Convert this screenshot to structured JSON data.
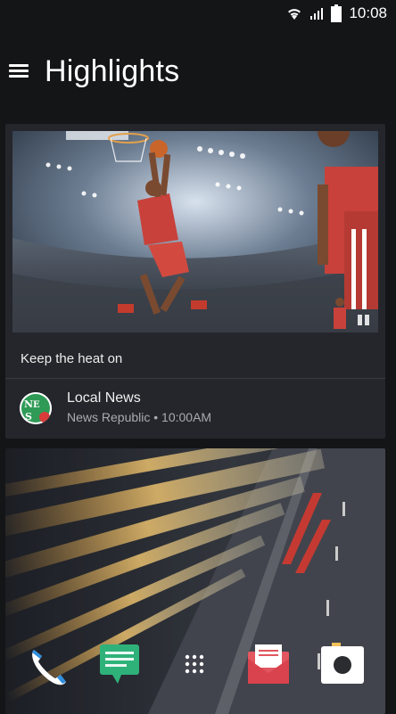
{
  "status_bar": {
    "time": "10:08",
    "icons": [
      "wifi-icon",
      "signal-icon",
      "battery-icon"
    ]
  },
  "header": {
    "menu_icon": "hamburger-menu-icon",
    "title": "Highlights"
  },
  "feed": {
    "cards": [
      {
        "image": "basketball-dunk-photo",
        "has_video": true,
        "headline": "Keep the heat on",
        "source_name": "Local News",
        "source_meta": "News Republic • 10:00AM"
      },
      {
        "image": "highway-motion-blur-photo"
      }
    ]
  },
  "dock": {
    "apps": [
      "phone-icon",
      "messages-icon",
      "app-drawer-icon",
      "mail-icon",
      "camera-icon"
    ]
  },
  "colors": {
    "background": "#141517",
    "card": "#25262c",
    "meta_text": "#a9abb2",
    "messages_green": "#2fb27a",
    "mail_red": "#e25760",
    "phone_blue": "#2f8fe0"
  }
}
